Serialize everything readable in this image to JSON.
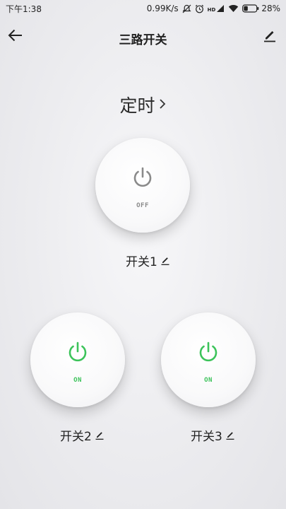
{
  "status_bar": {
    "time": "下午1:38",
    "network_speed": "0.99K/s",
    "signal_label": "HD",
    "battery_percent": "28%",
    "icons": [
      "mute-icon",
      "alarm-icon",
      "signal-icon",
      "wifi-icon",
      "battery-icon"
    ]
  },
  "header": {
    "title": "三路开关",
    "back_icon": "back-arrow-icon",
    "edit_icon": "pencil-icon"
  },
  "timer": {
    "label": "定时",
    "chevron": "›"
  },
  "switches": [
    {
      "label": "开关1",
      "state": "OFF",
      "color": "#8a8a8a",
      "edit_icon": "pencil-icon"
    },
    {
      "label": "开关2",
      "state": "ON",
      "color": "#3cc35a",
      "edit_icon": "pencil-icon"
    },
    {
      "label": "开关3",
      "state": "ON",
      "color": "#3cc35a",
      "edit_icon": "pencil-icon"
    }
  ],
  "colors": {
    "on": "#3cc35a",
    "off": "#8a8a8a",
    "background": "#ececef"
  }
}
